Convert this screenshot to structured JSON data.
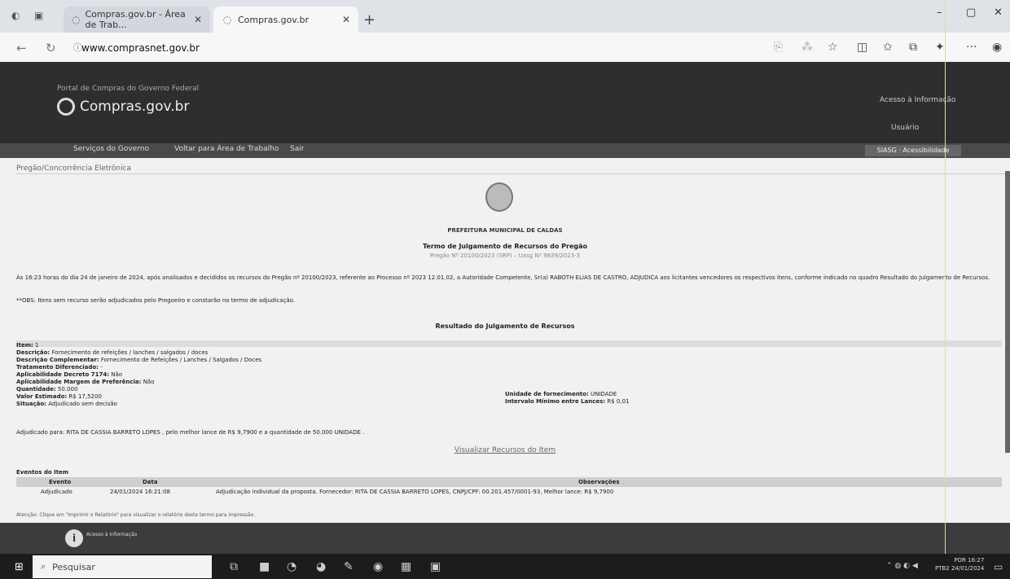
{
  "browser": {
    "tabs": [
      {
        "label": "Compras.gov.br - Área de Trab..."
      },
      {
        "label": "Compras.gov.br"
      }
    ],
    "new_tab": "+",
    "url": "www.comprasnet.gov.br",
    "window_controls": {
      "minimize": "–",
      "maximize": "▢",
      "close": "✕"
    }
  },
  "site": {
    "portal_label": "Portal de Compras do Governo Federal",
    "logo_text": "Compras.gov.br",
    "header_right_1": "Acesso à Informação",
    "header_right_2": "Usuário",
    "nav": [
      "Serviços do Governo",
      "Voltar para Área de Trabalho",
      "Sair"
    ],
    "nav_right": "SIASG · Acessibilidade"
  },
  "page": {
    "breadcrumb": "Pregão/Concorrência Eletrônica",
    "prefeitura": "PREFEITURA MUNICIPAL DE CALDAS",
    "termo_title": "Termo de Julgamento de Recursos do Pregão",
    "pregao_line": "Pregão Nº 20100/2023 (SRP) – Uasg Nº 9839/2023-3",
    "paragraph": "Às 16:23 horas do dia 24 de janeiro de 2024, após analisados e decididos os recursos do Pregão nº 20100/2023, referente ao Processo nº 2023 12.01.02, a Autoridade Competente, Sr(a) RABOTH ELIAS DE CASTRO, ADJUDICA aos licitantes vencedores os respectivos itens, conforme indicado no quadro Resultado do Julgamento de Recursos.",
    "obs": "**OBS: Itens sem recurso serão adjudicados pelo Pregoeiro e constarão no termo de adjudicação.",
    "resultado_title": "Resultado do Julgamento de Recursos",
    "item": {
      "item_label": "Item:",
      "item_value": "1",
      "desc_label": "Descrição:",
      "desc_value": "Fornecimento de refeições / lanches / salgados / doces",
      "desccomp_label": "Descrição Complementar:",
      "desccomp_value": "Fornecimento de Refeições / Lanches / Salgados / Doces",
      "trat_label": "Tratamento Diferenciado:",
      "trat_value": "-",
      "aplicdec_label": "Aplicabilidade Decreto 7174:",
      "aplicdec_value": "Não",
      "aplicmarg_label": "Aplicabilidade Margem de Preferência:",
      "aplicmarg_value": "Não",
      "qtd_label": "Quantidade:",
      "qtd_value": "50.000",
      "valor_label": "Valor Estimado:",
      "valor_value": "R$ 17,5200",
      "situacao_label": "Situação:",
      "situacao_value": "Adjudicado sem decisão",
      "unidade_label": "Unidade de fornecimento:",
      "unidade_value": "UNIDADE",
      "intervalo_label": "Intervalo Mínimo entre Lances:",
      "intervalo_value": "R$ 0,01"
    },
    "adjudicado": "Adjudicado para: RITA DE CASSIA BARRETO LOPES , pelo melhor lance de R$ 9,7900 e a quantidade de 50.000 UNIDADE .",
    "visualizar_link": "Visualizar Recursos do Item",
    "events": {
      "title": "Eventos do Item",
      "headers": [
        "Evento",
        "Data",
        "Observações"
      ],
      "row": {
        "evento": "Adjudicado",
        "data": "24/01/2024 16:21:08",
        "obs": "Adjudicação individual da proposta. Fornecedor: RITA DE CASSIA BARRETO LOPES, CNPJ/CPF: 00.201.457/0001-93, Melhor lance: R$ 9,7900"
      }
    },
    "footer_note": "Atenção: Clique em \"Imprimir o Relatório\" para visualizar o relatório deste termo para impressão.",
    "gov_label": "Acesso à Informação"
  },
  "taskbar": {
    "search_placeholder": "Pesquisar",
    "tray_line1": "POR  16:27",
    "tray_line2": "PTB2  24/01/2024"
  }
}
